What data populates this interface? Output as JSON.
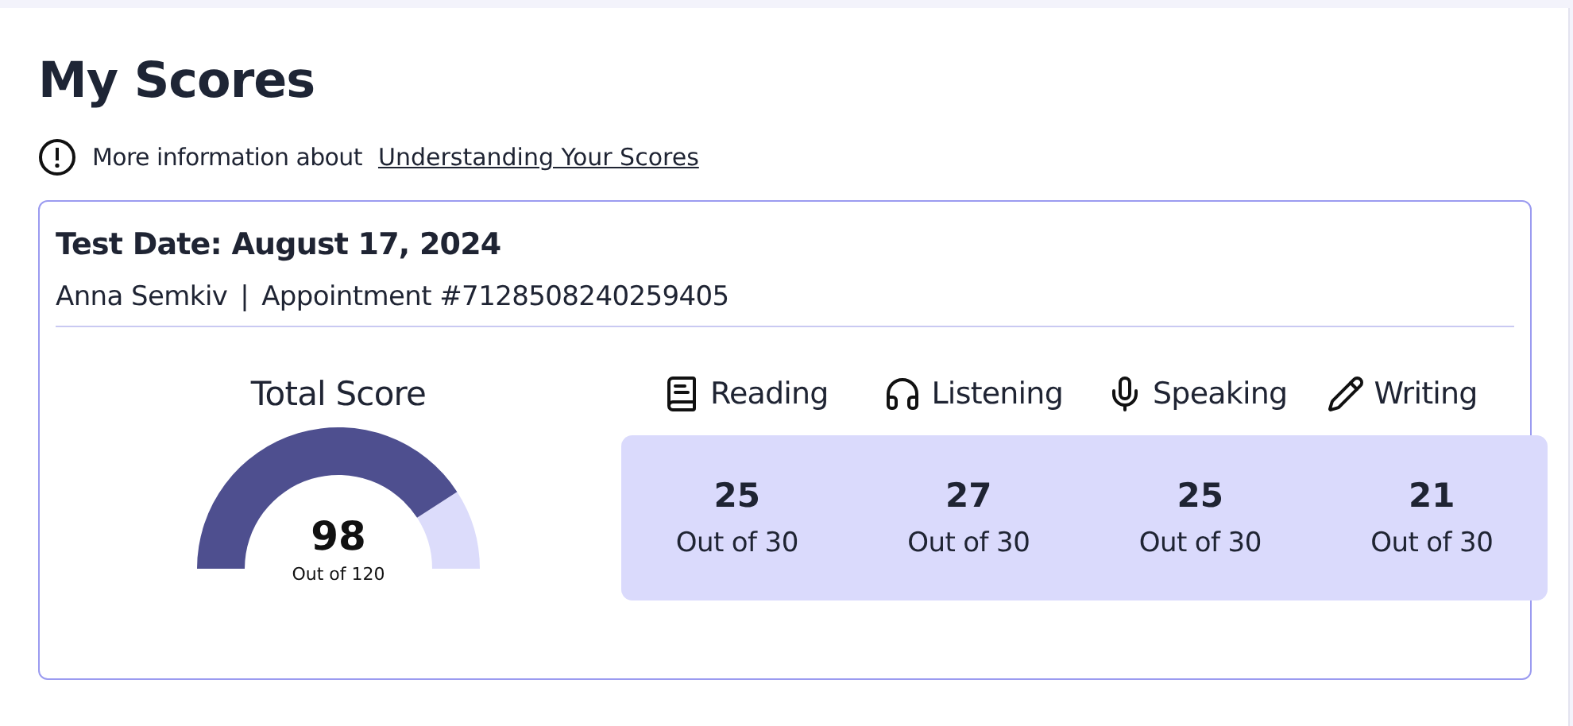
{
  "title": "My Scores",
  "info": {
    "text": "More information about",
    "link": "Understanding Your Scores"
  },
  "test": {
    "date": "Test Date: August 17, 2024",
    "name": "Anna Semkiv",
    "separator": "|",
    "appointment": "Appointment #7128508240259405"
  },
  "total": {
    "label": "Total Score",
    "score": "98",
    "out_of": "Out of 120"
  },
  "sections": [
    {
      "kind": "reading",
      "label": "Reading",
      "score": "25",
      "out_of": "Out of 30"
    },
    {
      "kind": "listening",
      "label": "Listening",
      "score": "27",
      "out_of": "Out of 30"
    },
    {
      "kind": "speaking",
      "label": "Speaking",
      "score": "25",
      "out_of": "Out of 30"
    },
    {
      "kind": "writing",
      "label": "Writing",
      "score": "21",
      "out_of": "Out of 30"
    }
  ]
}
